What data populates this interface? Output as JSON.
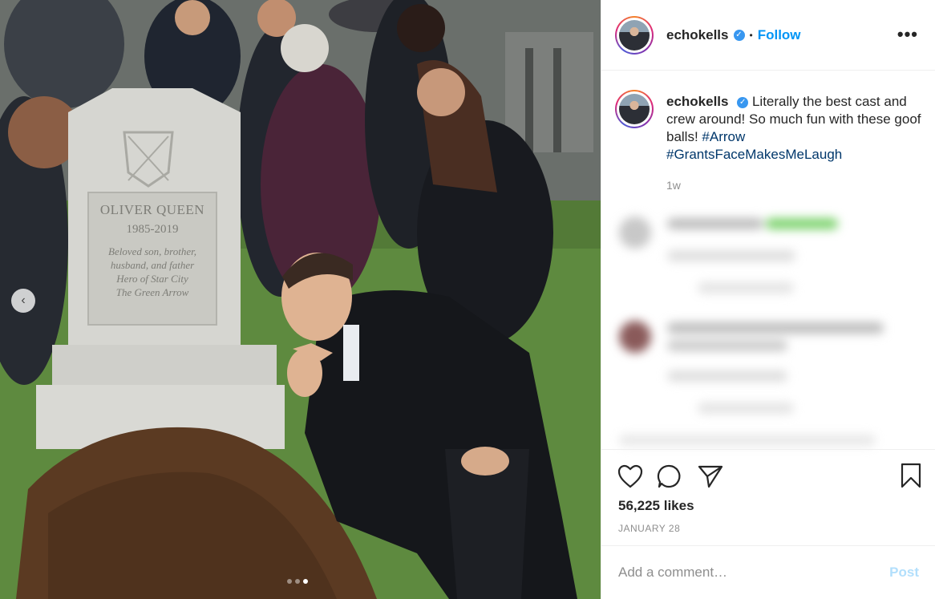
{
  "post": {
    "photo_alt": "",
    "carousel_prev_label": "‹",
    "carousel_dots": 3,
    "carousel_active_index": 2
  },
  "header": {
    "username": "echokells",
    "separator": "•",
    "follow_label": "Follow",
    "more_label": "•••"
  },
  "caption": {
    "username": "echokells",
    "text": "Literally the best cast and crew around! So much fun with these goof balls!",
    "hashtags": [
      "#Arrow",
      "#GrantsFaceMakesMeLaugh"
    ],
    "time": "1w"
  },
  "gravestone": {
    "name": "OLIVER QUEEN",
    "dates": "1985-2019",
    "epitaph_line1": "Beloved son, brother,",
    "epitaph_line2": "husband, and father",
    "epitaph_line3": "Hero of Star City",
    "epitaph_line4": "The Green Arrow"
  },
  "actions": {
    "likes": "56,225 likes",
    "date": "JANUARY 28"
  },
  "comment_box": {
    "placeholder": "Add a comment…",
    "post_label": "Post"
  },
  "colors": {
    "link_blue": "#0095f6",
    "verified_blue": "#3897f0",
    "post_disabled": "#b2dffc"
  }
}
